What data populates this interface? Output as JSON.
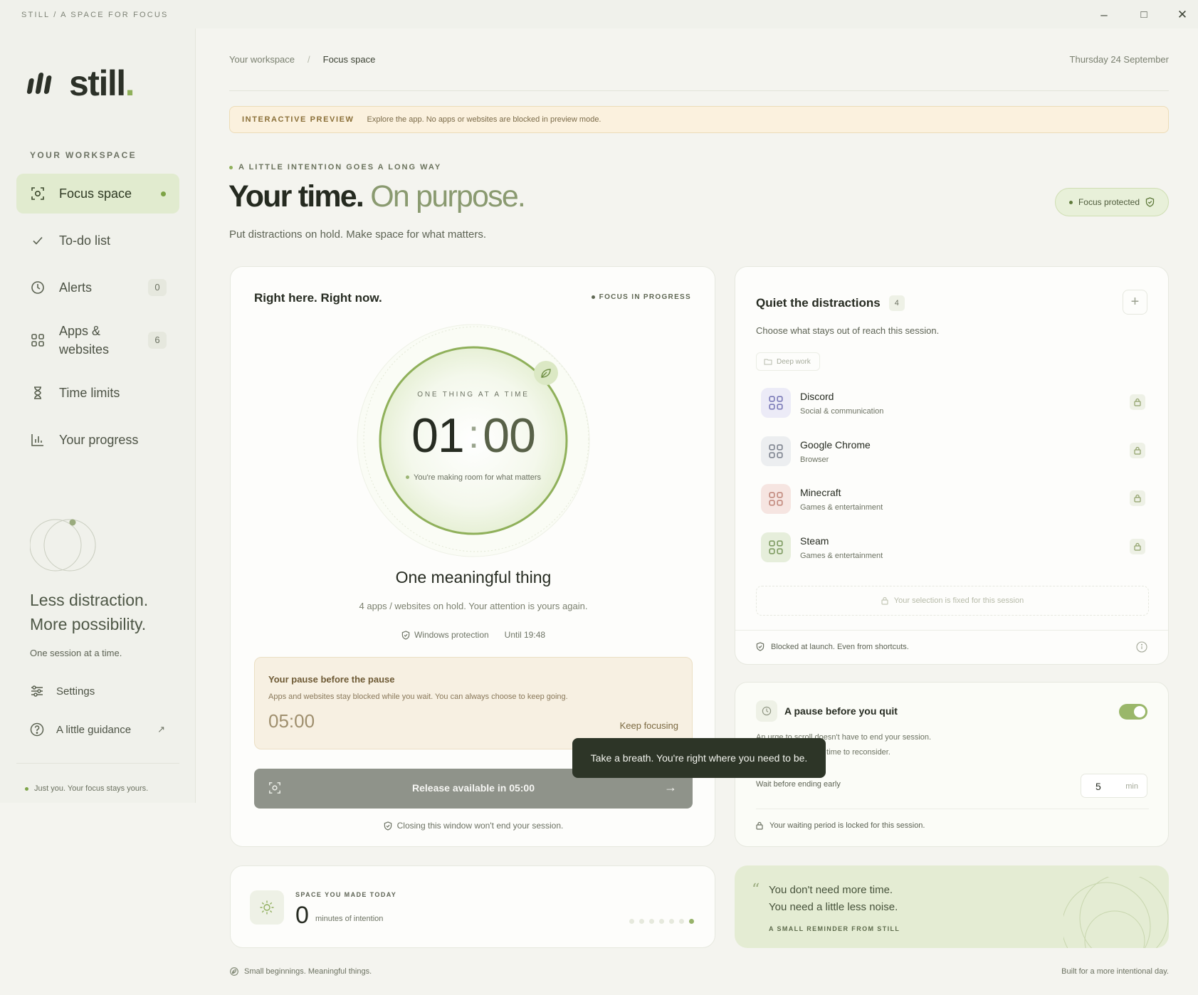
{
  "window": {
    "title": "STILL / A SPACE FOR FOCUS",
    "controls": {
      "minimize": "–",
      "maximize": "□",
      "close": "✕"
    }
  },
  "colors": {
    "accent": "#8fb05a",
    "accent_dark": "#7da346",
    "active_nav_bg": "#e1ebcf",
    "preview_bg": "#fbf1de",
    "button_disabled": "#8f938a",
    "tooltip_bg": "#2d3527"
  },
  "sidebar": {
    "logo_word": "still",
    "logo_dot": ".",
    "heading": "YOUR WORKSPACE",
    "items": [
      {
        "label": "Focus space",
        "icon": "focus-frame-icon",
        "active": true
      },
      {
        "label": "To-do list",
        "icon": "check-icon"
      },
      {
        "label": "Alerts",
        "icon": "clock-icon",
        "count": "0"
      },
      {
        "label": "Apps & websites",
        "icon": "grid-icon",
        "count": "6"
      },
      {
        "label": "Time limits",
        "icon": "hourglass-icon"
      },
      {
        "label": "Your progress",
        "icon": "bar-chart-icon"
      }
    ],
    "tagline_1": "Less distraction.",
    "tagline_2": "More possibility.",
    "tagline_sub": "One session at a time.",
    "settings_label": "Settings",
    "guidance_label": "A little guidance",
    "guidance_ext": "↗",
    "footer_note": "Just you. Your focus stays yours."
  },
  "header": {
    "breadcrumb_root": "Your workspace",
    "breadcrumb_sep": "/",
    "breadcrumb_current": "Focus space",
    "date": "Thursday 24 September"
  },
  "preview_banner": {
    "label": "INTERACTIVE PREVIEW",
    "text": "Explore the app. No apps or websites are blocked in preview mode."
  },
  "hero": {
    "eyebrow": "A LITTLE INTENTION GOES A LONG WAY",
    "title_strong": "Your time.",
    "title_muted": "On purpose.",
    "subtitle": "Put distractions on hold. Make space for what matters.",
    "badge": "Focus protected"
  },
  "timer_card": {
    "title": "Right here. Right now.",
    "status": "FOCUS IN PROGRESS",
    "ring_eyebrow": "ONE THING AT A TIME",
    "minutes": "01",
    "colon": ":",
    "seconds": "00",
    "ring_message": "You're making room for what matters",
    "heading": "One meaningful thing",
    "subtext": "4 apps / websites on hold. Your attention is yours again.",
    "protection": "Windows protection",
    "until": "Until 19:48",
    "pause": {
      "title": "Your pause before the pause",
      "text": "Apps and websites stay blocked while you wait. You can always choose to keep going.",
      "time": "05:00",
      "keep": "Keep focusing"
    },
    "release_label": "Release available in 05:00",
    "release_arrow": "→",
    "close_note": "Closing this window won't end your session."
  },
  "tooltip": "Take a breath. You're right where you need to be.",
  "distractions": {
    "title": "Quiet the distractions",
    "count": "4",
    "add": "+",
    "subtitle": "Choose what stays out of reach this session.",
    "preset": "Deep work",
    "apps": [
      {
        "name": "Discord",
        "category": "Social & communication",
        "tint": "#ecebf7",
        "stroke": "#7c7bb8"
      },
      {
        "name": "Google Chrome",
        "category": "Browser",
        "tint": "#eceef0",
        "stroke": "#7f8590"
      },
      {
        "name": "Minecraft",
        "category": "Games & entertainment",
        "tint": "#f6e5e1",
        "stroke": "#c28a7e"
      },
      {
        "name": "Steam",
        "category": "Games & entertainment",
        "tint": "#e6eedb",
        "stroke": "#7f9c63"
      }
    ],
    "fixed_note": "Your selection is fixed for this session",
    "footer": "Blocked at launch. Even from shortcuts."
  },
  "quit": {
    "title": "A pause before you quit",
    "desc_1": "An urge to scroll doesn't have to end your session.",
    "desc_2": "Give yourself a little time to reconsider.",
    "wait_label": "Wait before ending early",
    "wait_value": "5",
    "wait_unit": "min",
    "footer": "Your waiting period is locked for this session.",
    "enabled": true
  },
  "today": {
    "label": "SPACE YOU MADE TODAY",
    "value": "0",
    "unit": "minutes of intention"
  },
  "quote": {
    "mark": "“",
    "line_1": "You don't need more time.",
    "line_2": "You need a little less noise.",
    "source": "A SMALL REMINDER FROM STILL"
  },
  "footer": {
    "left": "Small beginnings. Meaningful things.",
    "right": "Built for a more intentional day."
  }
}
